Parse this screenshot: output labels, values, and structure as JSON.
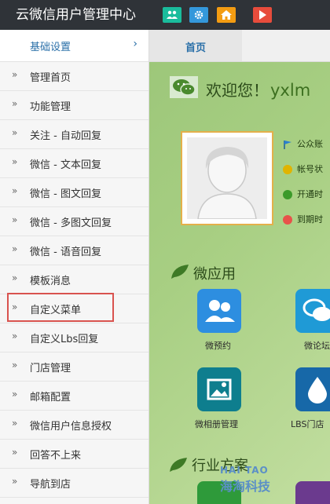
{
  "header": {
    "title": "云微信用户管理中心",
    "buttons": [
      {
        "icon": "users-icon",
        "color": "#1abc9c"
      },
      {
        "icon": "gear-icon",
        "color": "#3498db"
      },
      {
        "icon": "home-icon",
        "color": "#f39c12"
      },
      {
        "icon": "play-icon",
        "color": "#e74c3c"
      }
    ]
  },
  "sidebar": {
    "section_label": "基础设置",
    "items": [
      {
        "label": "管理首页"
      },
      {
        "label": "功能管理"
      },
      {
        "label": "关注 - 自动回复"
      },
      {
        "label": "微信 - 文本回复"
      },
      {
        "label": "微信 - 图文回复"
      },
      {
        "label": "微信 - 多图文回复"
      },
      {
        "label": "微信 - 语音回复"
      },
      {
        "label": "模板消息"
      },
      {
        "label": "自定义菜单"
      },
      {
        "label": "自定义Lbs回复"
      },
      {
        "label": "门店管理"
      },
      {
        "label": "邮箱配置"
      },
      {
        "label": "微信用户信息授权"
      },
      {
        "label": "回答不上来"
      },
      {
        "label": "导航到店"
      }
    ],
    "highlighted_item": "自定义菜单"
  },
  "tabs": {
    "home": "首页"
  },
  "main": {
    "welcome": "欢迎您！",
    "username": "yxlm",
    "info": [
      {
        "text": "公众账",
        "icon": "flag-icon"
      },
      {
        "text": "帐号状",
        "icon": "alert-icon"
      },
      {
        "text": "开通时",
        "icon": "check-icon"
      },
      {
        "text": "到期时",
        "icon": "clock-icon"
      }
    ],
    "apps_title": "微应用",
    "apps": [
      {
        "label": "微预约",
        "icon": "users-icon",
        "color": "#2d8ee0"
      },
      {
        "label": "微论坛",
        "icon": "chat-icon",
        "color": "#1f9ad6"
      },
      {
        "label": "微相册管理",
        "icon": "picture-icon",
        "color": "#0e7e8e"
      },
      {
        "label": "LBS门店",
        "icon": "drop-icon",
        "color": "#1768a8"
      }
    ],
    "industry_title": "行业方案"
  },
  "watermark": {
    "line1": "HAI TAO",
    "line2": "海淘科技"
  }
}
